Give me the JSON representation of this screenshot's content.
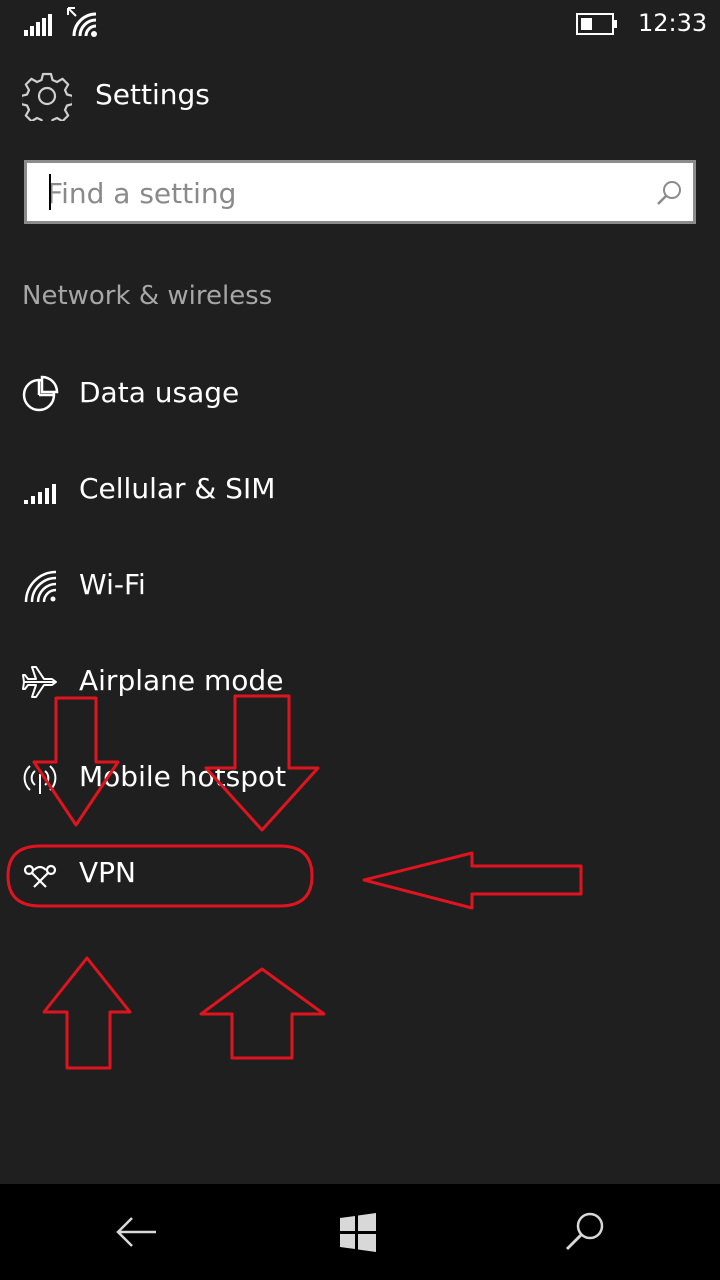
{
  "status_bar": {
    "time": "12:33",
    "signal_icon": "signal-bars-icon",
    "wifi_icon": "wifi-icon",
    "battery_icon": "battery-icon"
  },
  "header": {
    "icon": "gear-icon",
    "title": "Settings"
  },
  "search": {
    "placeholder": "Find a setting",
    "value": "",
    "icon": "search-icon"
  },
  "section": {
    "title": "Network & wireless"
  },
  "items": [
    {
      "label": "Data usage",
      "icon": "pie-chart-icon"
    },
    {
      "label": "Cellular & SIM",
      "icon": "signal-bars-icon"
    },
    {
      "label": "Wi-Fi",
      "icon": "wifi-icon"
    },
    {
      "label": "Airplane mode",
      "icon": "airplane-icon"
    },
    {
      "label": "Mobile hotspot",
      "icon": "hotspot-icon"
    },
    {
      "label": "VPN",
      "icon": "vpn-icon"
    }
  ],
  "navbar": {
    "back_icon": "back-arrow-icon",
    "home_icon": "windows-start-icon",
    "search_icon": "search-icon"
  },
  "colors": {
    "background": "#1f1f1f",
    "navbar": "#000000",
    "secondary_text": "#a6a6a6",
    "annotation": "#e0141e"
  }
}
